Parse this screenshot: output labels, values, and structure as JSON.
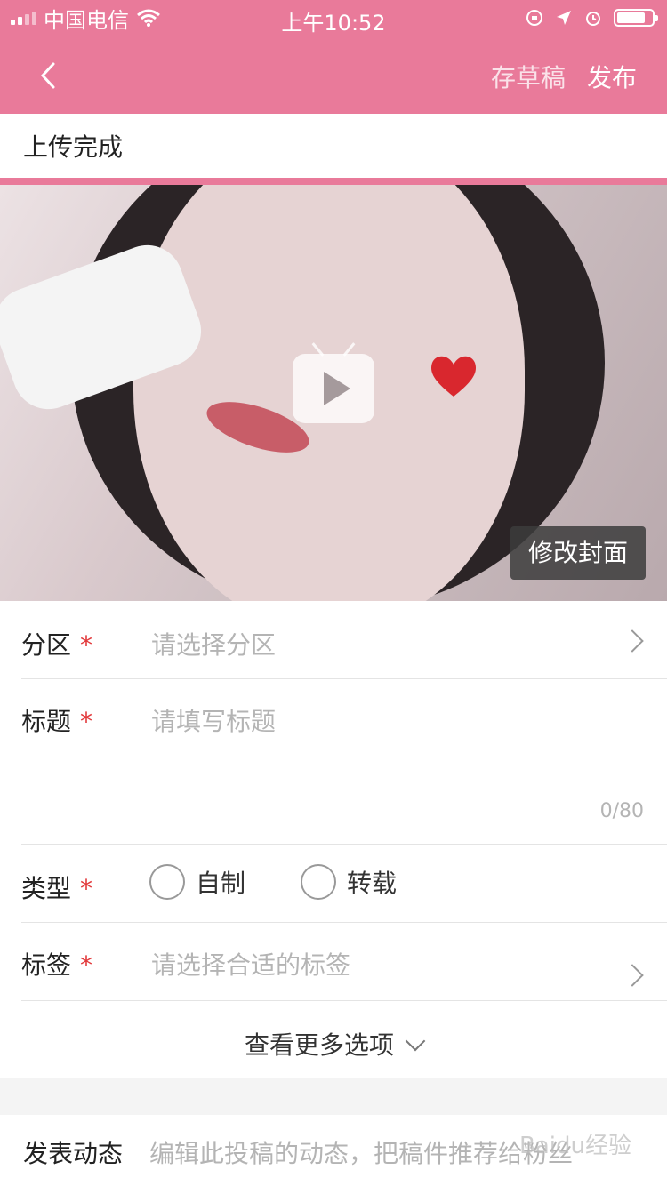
{
  "status_bar": {
    "carrier": "中国电信",
    "time": "上午10:52",
    "icons": [
      "signal-icon",
      "wifi-icon",
      "orientation-lock-icon",
      "location-icon",
      "alarm-icon",
      "battery-icon"
    ],
    "battery_level": 0.85
  },
  "nav": {
    "back_icon": "chevron-left-icon",
    "draft_label": "存草稿",
    "publish_label": "发布",
    "color": "#e97a9a"
  },
  "upload": {
    "status": "上传完成",
    "progress": 1.0
  },
  "cover": {
    "play_icon": "tv-play-icon",
    "edit_label": "修改封面"
  },
  "form": {
    "section": {
      "label": "分区",
      "required": "*",
      "placeholder": "请选择分区"
    },
    "title": {
      "label": "标题",
      "required": "*",
      "placeholder": "请填写标题",
      "counter": "0/80"
    },
    "type": {
      "label": "类型",
      "required": "*",
      "options": [
        "自制",
        "转载"
      ]
    },
    "tags": {
      "label": "标签",
      "required": "*",
      "placeholder": "请选择合适的标签"
    },
    "more_options": "查看更多选项"
  },
  "post": {
    "label": "发表动态",
    "placeholder": "编辑此投稿的动态，把稿件推荐给粉丝"
  },
  "watermark": "Baidu经验"
}
